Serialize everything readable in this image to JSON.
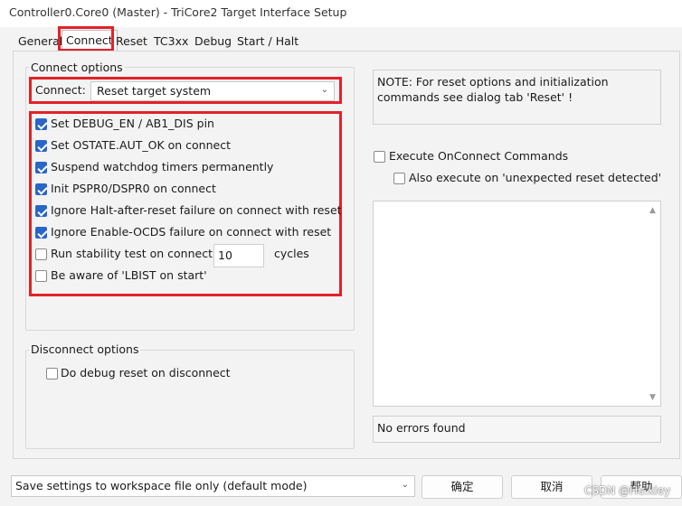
{
  "window": {
    "title": "Controller0.Core0 (Master) - TriCore2 Target Interface Setup"
  },
  "tabs": [
    {
      "label": "General"
    },
    {
      "label": "Connect"
    },
    {
      "label": "Reset"
    },
    {
      "label": "TC3xx"
    },
    {
      "label": "Debug"
    },
    {
      "label": "Start / Halt"
    }
  ],
  "connect_options": {
    "group_label": "Connect options",
    "connect_label": "Connect:",
    "connect_value": "Reset target system",
    "checkboxes": [
      {
        "label": "Set DEBUG_EN / AB1_DIS pin",
        "checked": true
      },
      {
        "label": "Set OSTATE.AUT_OK on connect",
        "checked": true
      },
      {
        "label": "Suspend watchdog timers permanently",
        "checked": true
      },
      {
        "label": "Init PSPR0/DSPR0 on connect",
        "checked": true
      },
      {
        "label": "Ignore Halt-after-reset failure on connect with reset",
        "checked": true
      },
      {
        "label": "Ignore Enable-OCDS failure on connect with reset",
        "checked": true
      },
      {
        "label": "Run stability test on connect",
        "checked": false
      },
      {
        "label": "Be aware of 'LBIST on start'",
        "checked": false
      }
    ],
    "stability_cycles_value": "10",
    "stability_cycles_unit": "cycles"
  },
  "disconnect_options": {
    "group_label": "Disconnect options",
    "debug_reset_label": "Do debug reset on disconnect",
    "debug_reset_checked": false
  },
  "note": {
    "text": "NOTE: For reset options and initialization commands see dialog tab 'Reset' !"
  },
  "onconnect": {
    "execute_label": "Execute OnConnect Commands",
    "execute_checked": false,
    "also_execute_label": "Also execute on 'unexpected reset detected'",
    "also_execute_checked": false
  },
  "status": {
    "text": "No errors found"
  },
  "footer": {
    "save_mode_value": "Save settings to workspace file only (default mode)",
    "ok_label": "确定",
    "cancel_label": "取消",
    "help_label": "帮助"
  },
  "watermark": "CSDN @Hu.kiey",
  "colors": {
    "highlight_red": "#e32128",
    "checkbox_blue": "#2a66c8"
  }
}
